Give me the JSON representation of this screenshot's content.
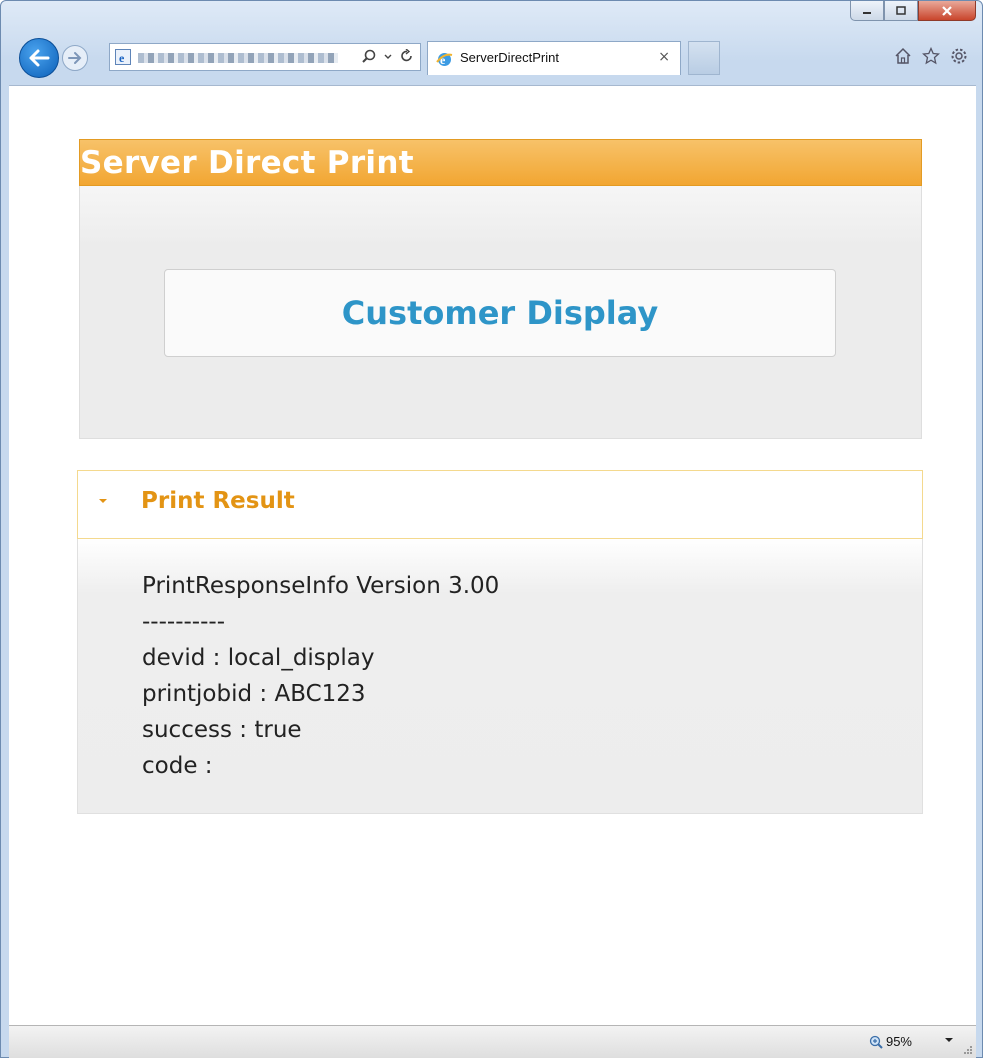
{
  "browser": {
    "tab_title": "ServerDirectPrint",
    "tab_close": "×",
    "zoom": "95%"
  },
  "page": {
    "banner_title": "Server Direct Print",
    "customer_display_button": "Customer Display",
    "result_title": "Print Result",
    "result_lines": [
      "PrintResponseInfo Version 3.00",
      "----------",
      "devid : local_display",
      "printjobid : ABC123",
      "success : true",
      "code :"
    ]
  },
  "colors": {
    "banner": "#f2a632",
    "accent_blue": "#2e95c8",
    "accent_orange": "#e39414"
  }
}
